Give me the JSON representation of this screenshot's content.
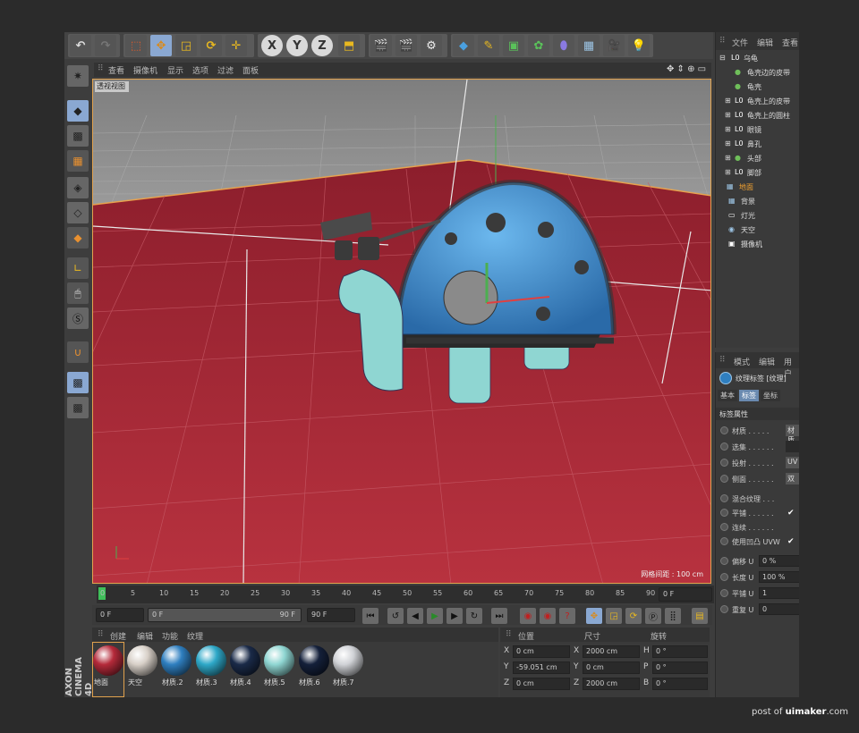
{
  "toolbar": {
    "undo_icon": "undo-icon",
    "redo_icon": "redo-icon",
    "axis_x": "X",
    "axis_y": "Y",
    "axis_z": "Z"
  },
  "viewport": {
    "menu": [
      "查看",
      "摄像机",
      "显示",
      "选项",
      "过滤",
      "面板"
    ],
    "label": "透视视图",
    "grid_spacing": "网格间距 : 100 cm"
  },
  "timeline": {
    "ticks": [
      "0",
      "5",
      "10",
      "15",
      "20",
      "25",
      "30",
      "35",
      "40",
      "45",
      "50",
      "55",
      "60",
      "65",
      "70",
      "75",
      "80",
      "85",
      "90"
    ],
    "current_frame": "0 F"
  },
  "playback": {
    "start": "0 F",
    "range_start": "0 F",
    "range_end": "90 F",
    "end": "90 F"
  },
  "materials": {
    "menu": [
      "创建",
      "编辑",
      "功能",
      "纹理"
    ],
    "items": [
      {
        "name": "地面",
        "color": "#b52a3a"
      },
      {
        "name": "天空",
        "color": "#d8d0c8"
      },
      {
        "name": "材质.2",
        "color": "#2f7fc0"
      },
      {
        "name": "材质.3",
        "color": "#2ea8c8"
      },
      {
        "name": "材质.4",
        "color": "#1a2a48"
      },
      {
        "name": "材质.5",
        "color": "#8fd6d2"
      },
      {
        "name": "材质.6",
        "color": "#14203a"
      },
      {
        "name": "材质.7",
        "color": "#d0d2d6"
      }
    ]
  },
  "coordinates": {
    "headers": [
      "位置",
      "尺寸",
      "旋转"
    ],
    "rows": [
      {
        "pos_label": "X",
        "pos": "0 cm",
        "size_label": "X",
        "size": "2000 cm",
        "rot_label": "H",
        "rot": "0 °"
      },
      {
        "pos_label": "Y",
        "pos": "-59.051 cm",
        "size_label": "Y",
        "size": "0 cm",
        "rot_label": "P",
        "rot": "0 °"
      },
      {
        "pos_label": "Z",
        "pos": "0 cm",
        "size_label": "Z",
        "size": "2000 cm",
        "rot_label": "B",
        "rot": "0 °"
      }
    ]
  },
  "object_manager": {
    "menu": [
      "文件",
      "编辑",
      "查看"
    ],
    "items": [
      {
        "icon": "L0",
        "name": "乌龟"
      },
      {
        "icon": "●",
        "name": "龟壳边的皮带"
      },
      {
        "icon": "●",
        "name": "龟壳"
      },
      {
        "icon": "L0",
        "name": "龟壳上的皮带"
      },
      {
        "icon": "L0",
        "name": "龟壳上的圆柱"
      },
      {
        "icon": "L0",
        "name": "眼镜"
      },
      {
        "icon": "L0",
        "name": "鼻孔"
      },
      {
        "icon": "●",
        "name": "头部"
      },
      {
        "icon": "L0",
        "name": "脚部"
      },
      {
        "icon": "▦",
        "name": "地面"
      },
      {
        "icon": "▦",
        "name": "背景"
      },
      {
        "icon": "▭",
        "name": "灯光"
      },
      {
        "icon": "◉",
        "name": "天空"
      },
      {
        "icon": "▣",
        "name": "摄像机"
      }
    ]
  },
  "attributes": {
    "menu": [
      "模式",
      "编辑",
      "用户"
    ],
    "tag_title": "纹理标签 [纹理]",
    "tabs": [
      "基本",
      "标签",
      "坐标"
    ],
    "section": "标签属性",
    "rows": [
      {
        "label": "材质 . . . . .",
        "value": "材质"
      },
      {
        "label": "选集 . . . . . .",
        "value": ""
      },
      {
        "label": "投射 . . . . . .",
        "value": "UV"
      },
      {
        "label": "侧面 . . . . . .",
        "value": "双"
      },
      {
        "label": "混合纹理 . . .",
        "check": ""
      },
      {
        "label": "平铺 . . . . . .",
        "check": "✔"
      },
      {
        "label": "连续 . . . . . .",
        "check": ""
      },
      {
        "label": "使用凹凸 UVW",
        "check": "✔"
      },
      {
        "label": "偏移 U",
        "value": "0 %"
      },
      {
        "label": "长度 U",
        "value": "100 %"
      },
      {
        "label": "平铺 U",
        "value": "1"
      },
      {
        "label": "重复 U",
        "value": "0"
      }
    ]
  },
  "branding": {
    "vertical": "AXON CINEMA 4D"
  },
  "watermark": {
    "prefix": "post of",
    "site": "uimaker",
    "suffix": ".com"
  }
}
